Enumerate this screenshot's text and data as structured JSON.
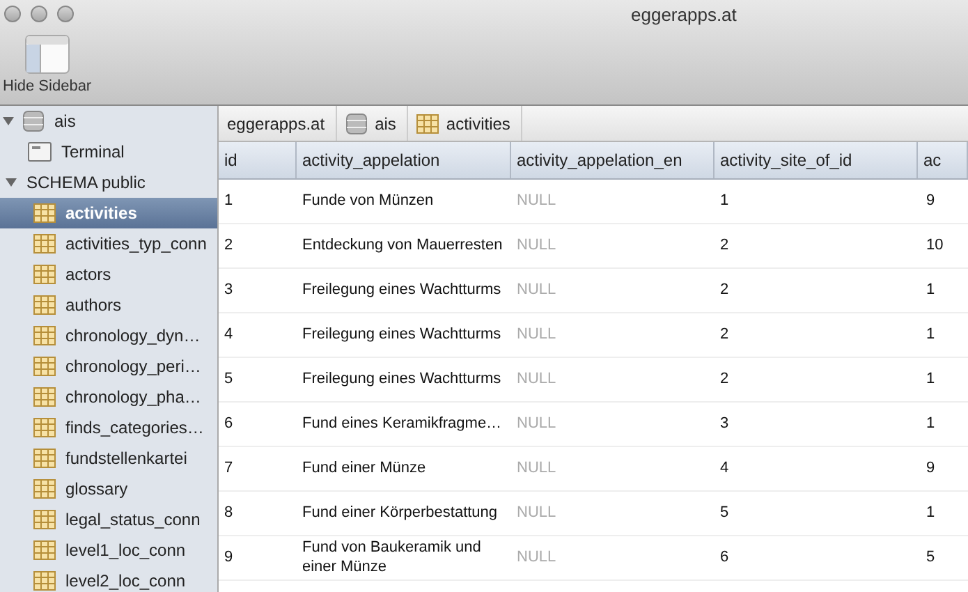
{
  "window": {
    "title": "eggerapps.at"
  },
  "toolbar": {
    "buttons": [
      {
        "label": "Hide Sidebar"
      }
    ]
  },
  "sidebar": {
    "items": [
      {
        "label": "ais",
        "kind": "database",
        "expanded": true,
        "selected": false,
        "children": [
          {
            "label": "Terminal",
            "kind": "terminal",
            "selected": false
          },
          {
            "label": "SCHEMA public",
            "kind": "schema",
            "expanded": true,
            "selected": false,
            "children": [
              {
                "label": "activities",
                "kind": "table",
                "selected": true
              },
              {
                "label": "activities_typ_conn",
                "kind": "table",
                "selected": false
              },
              {
                "label": "actors",
                "kind": "table",
                "selected": false
              },
              {
                "label": "authors",
                "kind": "table",
                "selected": false
              },
              {
                "label": "chronology_dyn…",
                "kind": "table",
                "selected": false
              },
              {
                "label": "chronology_peri…",
                "kind": "table",
                "selected": false
              },
              {
                "label": "chronology_pha…",
                "kind": "table",
                "selected": false
              },
              {
                "label": "finds_categories…",
                "kind": "table",
                "selected": false
              },
              {
                "label": "fundstellenkartei",
                "kind": "table",
                "selected": false
              },
              {
                "label": "glossary",
                "kind": "table",
                "selected": false
              },
              {
                "label": "legal_status_conn",
                "kind": "table",
                "selected": false
              },
              {
                "label": "level1_loc_conn",
                "kind": "table",
                "selected": false
              },
              {
                "label": "level2_loc_conn",
                "kind": "table",
                "selected": false
              }
            ]
          }
        ]
      }
    ]
  },
  "breadcrumb": [
    {
      "label": "eggerapps.at",
      "kind": "server"
    },
    {
      "label": "ais",
      "kind": "database"
    },
    {
      "label": "activities",
      "kind": "table"
    }
  ],
  "table": {
    "columns": [
      "id",
      "activity_appelation",
      "activity_appelation_en",
      "activity_site_of_id",
      "ac"
    ],
    "rows": [
      {
        "cells": [
          {
            "text": "1",
            "null": false
          },
          {
            "text": "Funde von Münzen",
            "null": false
          },
          {
            "text": "NULL",
            "null": true
          },
          {
            "text": "1",
            "null": false
          },
          {
            "text": "9",
            "null": false
          }
        ]
      },
      {
        "cells": [
          {
            "text": "2",
            "null": false
          },
          {
            "text": "Entdeckung von Mauerresten",
            "null": false
          },
          {
            "text": "NULL",
            "null": true
          },
          {
            "text": "2",
            "null": false
          },
          {
            "text": "10",
            "null": false
          }
        ]
      },
      {
        "cells": [
          {
            "text": "3",
            "null": false
          },
          {
            "text": "Freilegung eines Wachtturms",
            "null": false
          },
          {
            "text": "NULL",
            "null": true
          },
          {
            "text": "2",
            "null": false
          },
          {
            "text": "1",
            "null": false
          }
        ]
      },
      {
        "cells": [
          {
            "text": "4",
            "null": false
          },
          {
            "text": "Freilegung eines Wachtturms",
            "null": false
          },
          {
            "text": "NULL",
            "null": true
          },
          {
            "text": "2",
            "null": false
          },
          {
            "text": "1",
            "null": false
          }
        ]
      },
      {
        "cells": [
          {
            "text": "5",
            "null": false
          },
          {
            "text": "Freilegung eines Wachtturms",
            "null": false
          },
          {
            "text": "NULL",
            "null": true
          },
          {
            "text": "2",
            "null": false
          },
          {
            "text": "1",
            "null": false
          }
        ]
      },
      {
        "cells": [
          {
            "text": "6",
            "null": false
          },
          {
            "text": "Fund eines Keramikfragme…",
            "null": false
          },
          {
            "text": "NULL",
            "null": true
          },
          {
            "text": "3",
            "null": false
          },
          {
            "text": "1",
            "null": false
          }
        ]
      },
      {
        "cells": [
          {
            "text": "7",
            "null": false
          },
          {
            "text": "Fund einer Münze",
            "null": false
          },
          {
            "text": "NULL",
            "null": true
          },
          {
            "text": "4",
            "null": false
          },
          {
            "text": "9",
            "null": false
          }
        ]
      },
      {
        "cells": [
          {
            "text": "8",
            "null": false
          },
          {
            "text": "Fund einer Körperbestattung",
            "null": false
          },
          {
            "text": "NULL",
            "null": true
          },
          {
            "text": "5",
            "null": false
          },
          {
            "text": "1",
            "null": false
          }
        ]
      },
      {
        "cells": [
          {
            "text": "9",
            "null": false
          },
          {
            "text": "Fund von Baukeramik und einer Münze",
            "null": false
          },
          {
            "text": "NULL",
            "null": true
          },
          {
            "text": "6",
            "null": false
          },
          {
            "text": "5",
            "null": false
          }
        ]
      }
    ]
  }
}
